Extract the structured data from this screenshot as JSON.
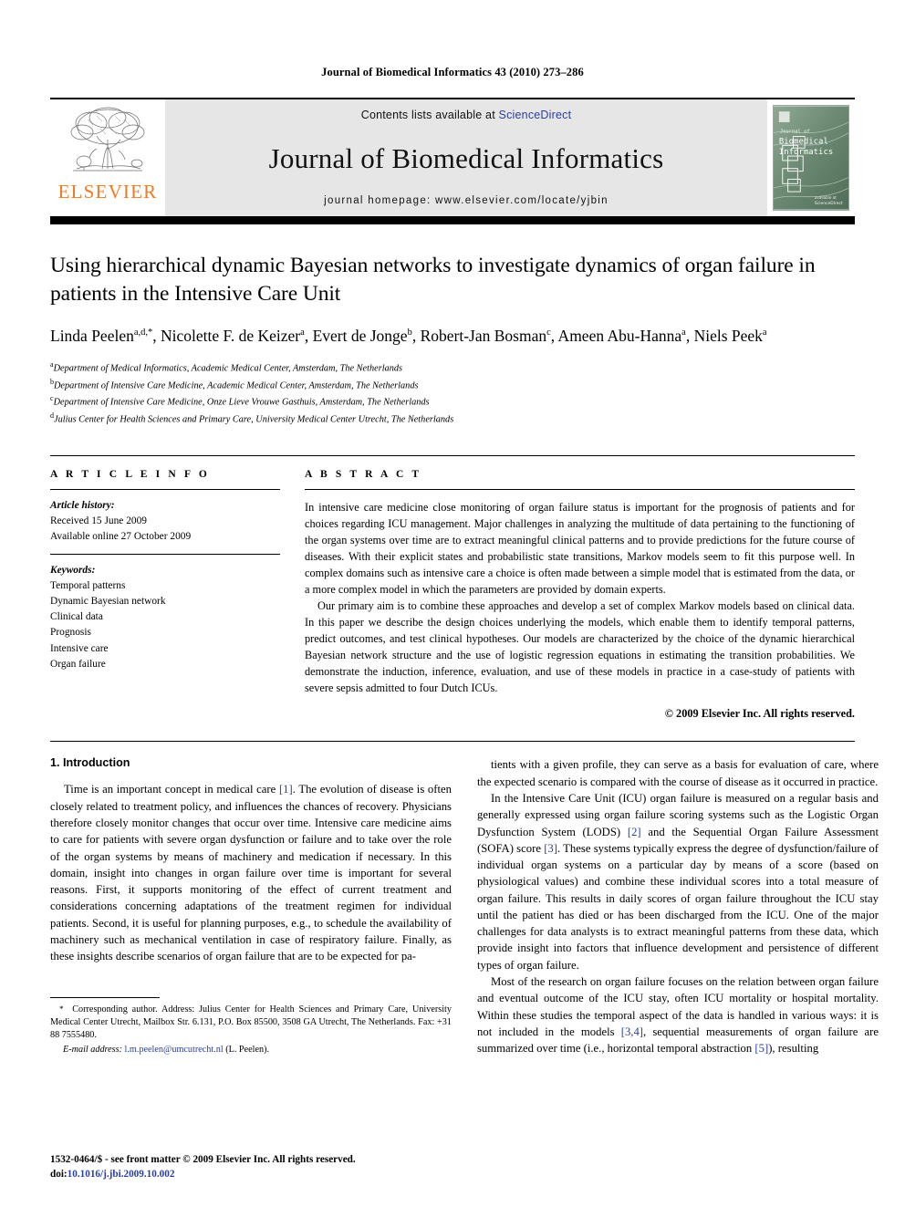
{
  "running_head": "Journal of Biomedical Informatics 43 (2010) 273–286",
  "masthead": {
    "contents_prefix": "Contents lists available at ",
    "sciencedirect": "ScienceDirect",
    "journal_name": "Journal of Biomedical Informatics",
    "homepage": "journal homepage: www.elsevier.com/locate/yjbin",
    "publisher_wordmark": "ELSEVIER",
    "publisher_color": "#F47920",
    "link_color": "#2b3fa0",
    "band_color": "#e6e6e6",
    "cover_title_line1": "Biomedical",
    "cover_title_line2": "Informatics"
  },
  "title": "Using hierarchical dynamic Bayesian networks to investigate dynamics of organ failure in patients in the Intensive Care Unit",
  "authors_html": "Linda Peelen<sup>a,d,</sup><sup>*</sup>, Nicolette F. de Keizer<sup>a</sup>, Evert de Jonge<sup>b</sup>, Robert-Jan Bosman<sup>c</sup>, Ameen Abu-Hanna<sup>a</sup>, Niels Peek<sup>a</sup>",
  "affiliations": [
    {
      "marker": "a",
      "text": "Department of Medical Informatics, Academic Medical Center, Amsterdam, The Netherlands"
    },
    {
      "marker": "b",
      "text": "Department of Intensive Care Medicine, Academic Medical Center, Amsterdam, The Netherlands"
    },
    {
      "marker": "c",
      "text": "Department of Intensive Care Medicine, Onze Lieve Vrouwe Gasthuis, Amsterdam, The Netherlands"
    },
    {
      "marker": "d",
      "text": "Julius Center for Health Sciences and Primary Care, University Medical Center Utrecht, The Netherlands"
    }
  ],
  "article_info": {
    "heading": "A R T I C L E    I N F O",
    "history_label": "Article history:",
    "history_lines": [
      "Received 15 June 2009",
      "Available online 27 October 2009"
    ],
    "keywords_label": "Keywords:",
    "keywords": [
      "Temporal patterns",
      "Dynamic Bayesian network",
      "Clinical data",
      "Prognosis",
      "Intensive care",
      "Organ failure"
    ]
  },
  "abstract": {
    "heading": "A B S T R A C T",
    "paragraph1": "In intensive care medicine close monitoring of organ failure status is important for the prognosis of patients and for choices regarding ICU management. Major challenges in analyzing the multitude of data pertaining to the functioning of the organ systems over time are to extract meaningful clinical patterns and to provide predictions for the future course of diseases. With their explicit states and probabilistic state transitions, Markov models seem to fit this purpose well. In complex domains such as intensive care a choice is often made between a simple model that is estimated from the data, or a more complex model in which the parameters are provided by domain experts.",
    "paragraph2": "Our primary aim is to combine these approaches and develop a set of complex Markov models based on clinical data. In this paper we describe the design choices underlying the models, which enable them to identify temporal patterns, predict outcomes, and test clinical hypotheses. Our models are characterized by the choice of the dynamic hierarchical Bayesian network structure and the use of logistic regression equations in estimating the transition probabilities. We demonstrate the induction, inference, evaluation, and use of these models in practice in a case-study of patients with severe sepsis admitted to four Dutch ICUs.",
    "copyright": "© 2009 Elsevier Inc. All rights reserved."
  },
  "body": {
    "section_title": "1. Introduction",
    "left_p1_html": "Time is an important concept in medical care <span class=\"ref\">[1]</span>. The evolution of disease is often closely related to treatment policy, and influences the chances of recovery. Physicians therefore closely monitor changes that occur over time. Intensive care medicine aims to care for patients with severe organ dysfunction or failure and to take over the role of the organ systems by means of machinery and medication if necessary. In this domain, insight into changes in organ failure over time is important for several reasons. First, it supports monitoring of the effect of current treatment and considerations concerning adaptations of the treatment regimen for individual patients. Second, it is useful for planning purposes, e.g., to schedule the availability of machinery such as mechanical ventilation in case of respiratory failure. Finally, as these insights describe scenarios of organ failure that are to be expected for pa-",
    "right_p1_html": "tients with a given profile, they can serve as a basis for evaluation of care, where the expected scenario is compared with the course of disease as it occurred in practice.",
    "right_p2_html": "In the Intensive Care Unit (ICU) organ failure is measured on a regular basis and generally expressed using organ failure scoring systems such as the Logistic Organ Dysfunction System (LODS) <span class=\"ref\">[2]</span> and the Sequential Organ Failure Assessment (SOFA) score <span class=\"ref\">[3]</span>. These systems typically express the degree of dysfunction/failure of individual organ systems on a particular day by means of a score (based on physiological values) and combine these individual scores into a total measure of organ failure. This results in daily scores of organ failure throughout the ICU stay until the patient has died or has been discharged from the ICU. One of the major challenges for data analysts is to extract meaningful patterns from these data, which provide insight into factors that influence development and persistence of different types of organ failure.",
    "right_p3_html": "Most of the research on organ failure focuses on the relation between organ failure and eventual outcome of the ICU stay, often ICU mortality or hospital mortality. Within these studies the temporal aspect of the data is handled in various ways: it is not included in the models <span class=\"ref\">[3,4]</span>, sequential measurements of organ failure are summarized over time (i.e., horizontal temporal abstraction <span class=\"ref\">[5]</span>), resulting"
  },
  "footnote": {
    "corresponding_html": "<span class=\"star\">*</span>&nbsp; Corresponding author. Address: Julius Center for Health Sciences and Primary Care, University Medical Center Utrecht, Mailbox Str. 6.131, P.O. Box 85500, 3508 GA Utrecht, The Netherlands. Fax: +31 88 7555480.",
    "email_label": "E-mail address:",
    "email": "l.m.peelen@umcutrecht.nl",
    "email_owner": "(L. Peelen)."
  },
  "page_footer": {
    "line1": "1532-0464/$ - see front matter © 2009 Elsevier Inc. All rights reserved.",
    "doi_label": "doi:",
    "doi_value": "10.1016/j.jbi.2009.10.002"
  }
}
